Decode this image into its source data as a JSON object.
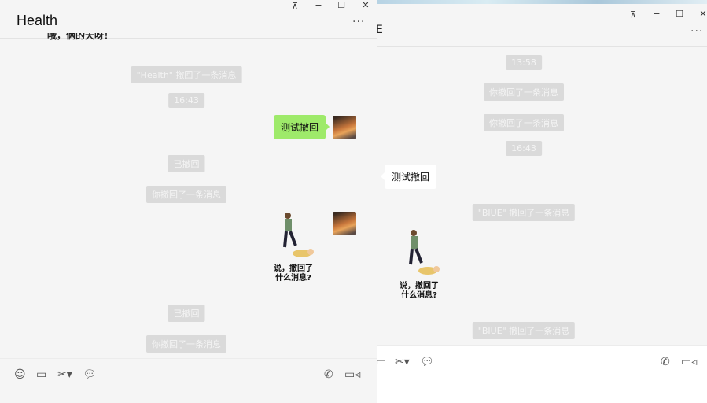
{
  "left_window": {
    "title": "Health",
    "controls": {
      "pin": "pin-icon",
      "minimize": "minimize-icon",
      "maximize": "maximize-icon",
      "close": "close-icon"
    },
    "partial_message": "哦，俩的天呀！",
    "messages": [
      {
        "type": "system",
        "text": "\"Health\" 撤回了一条消息"
      },
      {
        "type": "time",
        "text": "16:43"
      },
      {
        "type": "sent",
        "text": "测试撤回"
      },
      {
        "type": "system",
        "text": "已撤回"
      },
      {
        "type": "system",
        "text": "你撤回了一条消息"
      },
      {
        "type": "sticker",
        "caption_line1": "说，撤回了",
        "caption_line2": "什么消息?"
      },
      {
        "type": "system",
        "text": "已撤回"
      },
      {
        "type": "system",
        "text": "你撤回了一条消息"
      }
    ],
    "toolbar": [
      "emoji-icon",
      "folder-icon",
      "scissors-icon",
      "chat-bubble-icon",
      "phone-icon",
      "video-icon"
    ]
  },
  "right_window": {
    "title_partial": "E",
    "messages": [
      {
        "type": "time",
        "text": "13:58"
      },
      {
        "type": "system",
        "text": "你撤回了一条消息"
      },
      {
        "type": "system",
        "text": "你撤回了一条消息"
      },
      {
        "type": "time",
        "text": "16:43"
      },
      {
        "type": "received",
        "text": "测试撤回"
      },
      {
        "type": "system",
        "text": "\"BIUE\" 撤回了一条消息"
      },
      {
        "type": "sticker",
        "caption_line1": "说，撤回了",
        "caption_line2": "什么消息?"
      },
      {
        "type": "system",
        "text": "\"BIUE\" 撤回了一条消息"
      }
    ]
  },
  "colors": {
    "sent_bubble": "#9eea6a",
    "system_pill": "#dadada",
    "background": "#f5f5f5"
  }
}
